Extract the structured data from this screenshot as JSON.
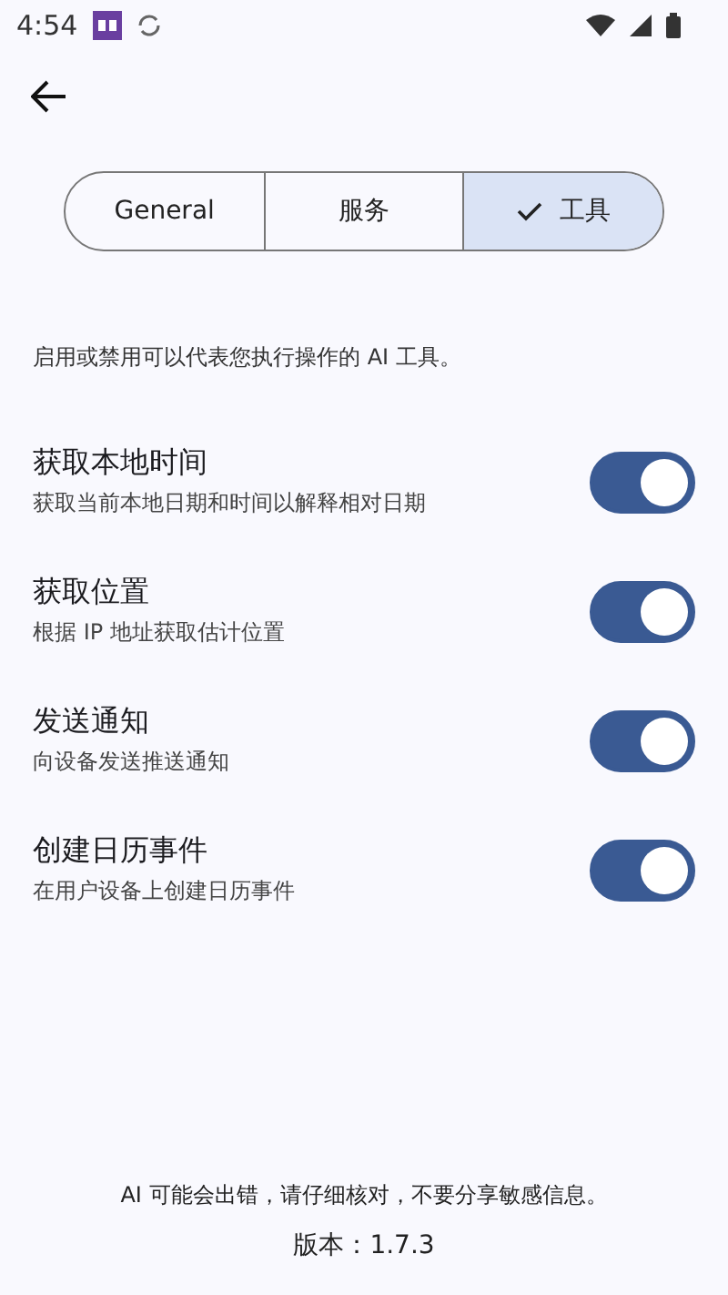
{
  "status_bar": {
    "time": "4:54"
  },
  "tabs": [
    {
      "label": "General",
      "selected": false
    },
    {
      "label": "服务",
      "selected": false
    },
    {
      "label": "工具",
      "selected": true
    }
  ],
  "description": "启用或禁用可以代表您执行操作的 AI 工具。",
  "tools": [
    {
      "title": "获取本地时间",
      "subtitle": "获取当前本地日期和时间以解释相对日期",
      "on": true
    },
    {
      "title": "获取位置",
      "subtitle": "根据 IP 地址获取估计位置",
      "on": true
    },
    {
      "title": "发送通知",
      "subtitle": "向设备发送推送通知",
      "on": true
    },
    {
      "title": "创建日历事件",
      "subtitle": "在用户设备上创建日历事件",
      "on": true
    }
  ],
  "disclaimer": "AI 可能会出错，请仔细核对，不要分享敏感信息。",
  "version": "版本：1.7.3"
}
